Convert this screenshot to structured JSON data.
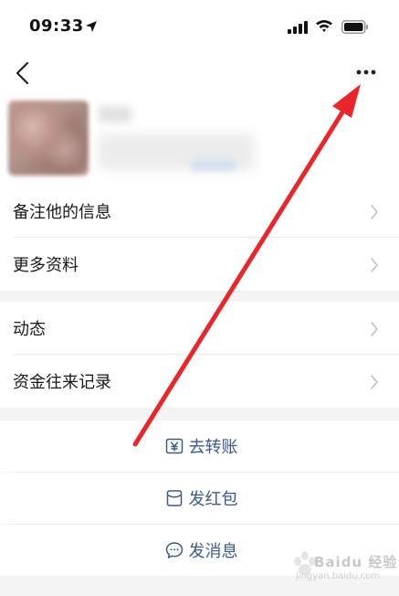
{
  "status_bar": {
    "time": "09:33"
  },
  "profile_rows": [
    {
      "label": "备注他的信息"
    },
    {
      "label": "更多资料"
    }
  ],
  "activity_rows": [
    {
      "label": "动态"
    },
    {
      "label": "资金往来记录"
    }
  ],
  "actions": [
    {
      "label": "去转账",
      "icon": "transfer-icon"
    },
    {
      "label": "发红包",
      "icon": "red-packet-icon"
    },
    {
      "label": "发消息",
      "icon": "chat-bubble-icon"
    }
  ],
  "watermark": {
    "text": "Baidu 经验",
    "sub": "jingyan.baidu.com"
  },
  "colors": {
    "action_text": "#3d5a8c",
    "annotation_arrow": "#e8262b",
    "background": "#f4f4f4"
  }
}
